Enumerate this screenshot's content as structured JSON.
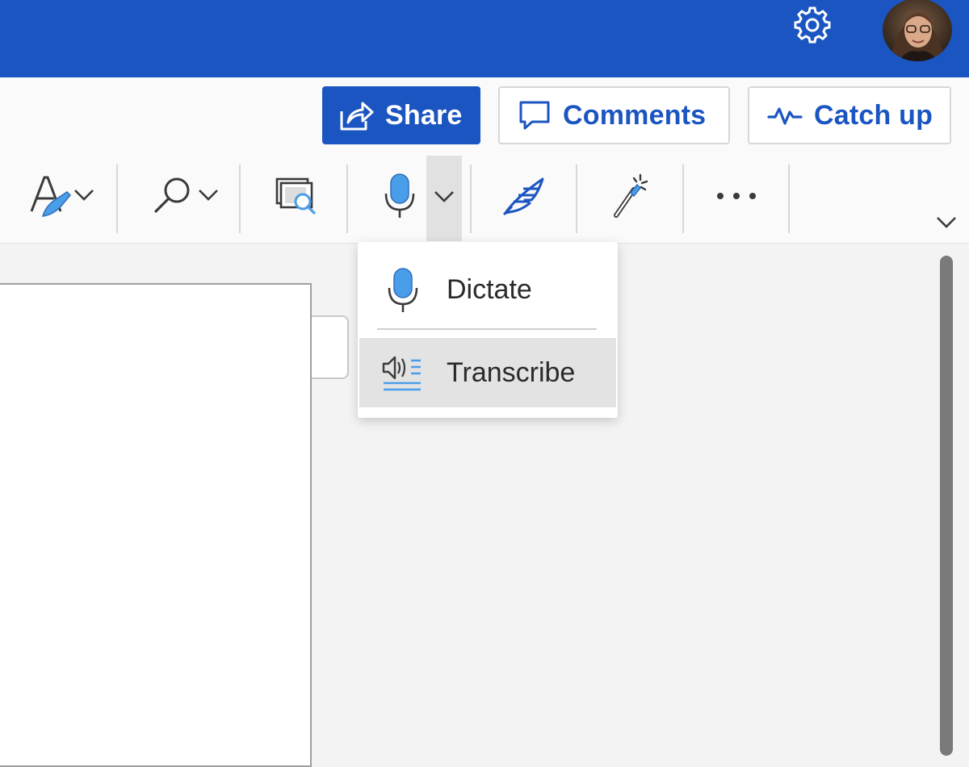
{
  "header": {
    "settings_icon": "gear-icon",
    "avatar_icon": "user-avatar"
  },
  "actions": {
    "share_label": "Share",
    "comments_label": "Comments",
    "catchup_label": "Catch up"
  },
  "toolbar": {
    "tools": [
      {
        "name": "editor",
        "icon": "editor-pen-icon",
        "has_dropdown": true
      },
      {
        "name": "find",
        "icon": "search-icon",
        "has_dropdown": true
      },
      {
        "name": "immersive-reader",
        "icon": "immersive-reader-icon",
        "has_dropdown": false
      },
      {
        "name": "dictate",
        "icon": "microphone-icon",
        "has_dropdown": true
      },
      {
        "name": "designer",
        "icon": "quill-icon",
        "has_dropdown": false
      },
      {
        "name": "copilot",
        "icon": "magic-wand-icon",
        "has_dropdown": false
      },
      {
        "name": "more",
        "icon": "more-icon",
        "has_dropdown": false
      }
    ]
  },
  "dictate_menu": {
    "items": [
      {
        "label": "Dictate",
        "icon": "microphone-icon"
      },
      {
        "label": "Transcribe",
        "icon": "transcribe-icon",
        "highlighted": true
      }
    ]
  },
  "colors": {
    "brand_blue": "#1b55c1",
    "mic_blue": "#4a9de8",
    "background": "#f3f3f3",
    "menu_hover": "#e3e3e3"
  }
}
